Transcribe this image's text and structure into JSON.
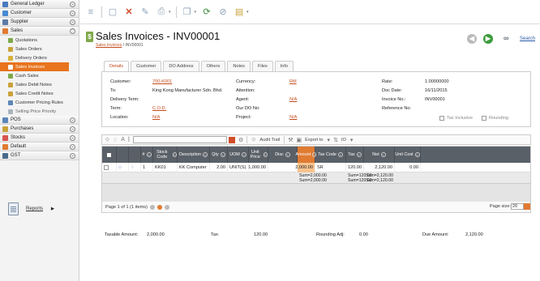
{
  "sidebar": {
    "groups": [
      {
        "label": "General Ledger",
        "color": "#4a7abf"
      },
      {
        "label": "Customer",
        "color": "#4a8ad0"
      },
      {
        "label": "Supplier",
        "color": "#5b7aa5"
      },
      {
        "label": "Sales",
        "color": "#e07b32"
      }
    ],
    "sales_items": [
      {
        "label": "Quotations",
        "color": "#7fa94a"
      },
      {
        "label": "Sales Orders",
        "color": "#c9a33a"
      },
      {
        "label": "Delivery Orders",
        "color": "#d9b13a"
      },
      {
        "label": "Sales Invoices",
        "color": "#ffffff"
      },
      {
        "label": "Cash Sales",
        "color": "#7fa94a"
      },
      {
        "label": "Sales Debit Notes",
        "color": "#c9a33a"
      },
      {
        "label": "Sales Credit Notes",
        "color": "#c9a33a"
      },
      {
        "label": "Customer Pricing Rules",
        "color": "#5b86b8"
      },
      {
        "label": "Selling Price Priority",
        "color": "#aab4bf"
      }
    ],
    "groups2": [
      {
        "label": "POS",
        "color": "#5b86b8"
      },
      {
        "label": "Purchases",
        "color": "#c9a33a"
      },
      {
        "label": "Stocks",
        "color": "#d9534f"
      },
      {
        "label": "Default",
        "color": "#e07b32"
      },
      {
        "label": "GST",
        "color": "#4a6a8a"
      }
    ],
    "reports": "Reports"
  },
  "header": {
    "title": "Sales Invoices - INV00001",
    "breadcrumb_link": "Sales Invoices",
    "breadcrumb_rest": " / INV00001",
    "search": "Search"
  },
  "tabs": [
    "Details",
    "Customer",
    "DO Address",
    "Others",
    "Notes",
    "Files",
    "Info"
  ],
  "details": {
    "customer_label": "Customer:",
    "customer": "700-K001",
    "to_label": "To:",
    "to": "King Kong Manufacturer Sdn. Bhd.",
    "delivery_term_label": "Delivery Term:",
    "term_label": "Term:",
    "term": "C.O.D.",
    "location_label": "Location:",
    "location": "N/A",
    "currency_label": "Currency:",
    "currency": "RM",
    "attention_label": "Attention:",
    "agent_label": "Agent:",
    "agent": "N/A",
    "our_do_label": "Our DO No:",
    "project_label": "Project:",
    "project": "N/A",
    "rate_label": "Rate:",
    "rate": "1.00000000",
    "doc_date_label": "Doc Date:",
    "doc_date": "16/11/2015",
    "invoice_no_label": "Invoice No.:",
    "invoice_no": "INV00001",
    "reference_label": "Reference No:",
    "tax_inclusive": "Tax Inclusive",
    "rounding": "Rounding"
  },
  "grid_toolbar": {
    "audit_trail": "Audit Trail",
    "export": "Export to",
    "io": "IO"
  },
  "grid": {
    "headers": [
      "#",
      "Stock Code",
      "Description",
      "Qty",
      "UOM",
      "Unit Price",
      "Disc",
      "Amount",
      "Tax Code",
      "Tax",
      "Net",
      "Unit Cost"
    ],
    "row": {
      "num": "1",
      "stock_code": "KK01",
      "description": "KK Computer",
      "qty": "2.00",
      "uom": "UNIT(S)",
      "unit_price": "1,000.00",
      "disc": "",
      "amount": "2,000.00",
      "tax_code": "SR",
      "tax": "120.00",
      "net": "2,120.00",
      "unit_cost": "0.00"
    },
    "summary": {
      "amount1": "Sum=2,000.00",
      "amount2": "Sum=2,000.00",
      "tax1": "Sum=120.00",
      "tax2": "Sum=120.00",
      "net1": "Sum=2,120.00",
      "net2": "Sum=2,120.00"
    },
    "pager": "Page 1 of 1 (1 items)",
    "page_size_label": "Page size:",
    "page_size": "20"
  },
  "totals": {
    "taxable_label": "Taxable Amount:",
    "taxable": "2,000.00",
    "tax_label": "Tax:",
    "tax": "120.00",
    "rounding_label": "Rounding Adj:",
    "rounding": "0.00",
    "due_label": "Due Amount:",
    "due": "2,120.00"
  }
}
